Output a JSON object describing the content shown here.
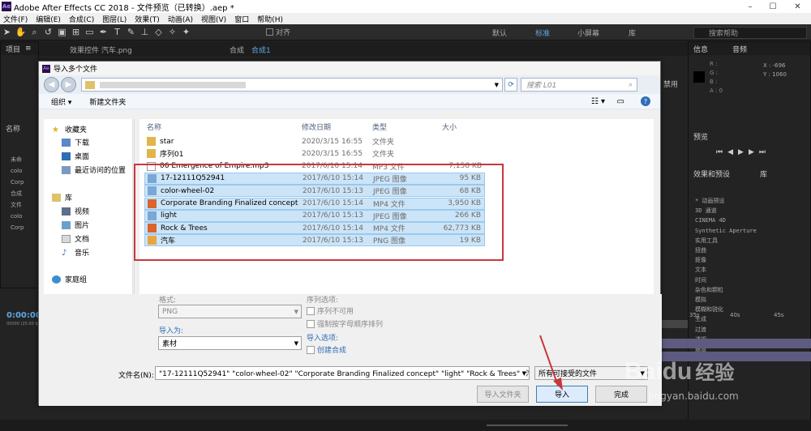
{
  "app": {
    "title": "Adobe After Effects CC 2018 - 文件预览（已转换）.aep *",
    "logo": "Ae"
  },
  "menu": [
    "文件(F)",
    "编辑(E)",
    "合成(C)",
    "图层(L)",
    "效果(T)",
    "动画(A)",
    "视图(V)",
    "窗口",
    "帮助(H)"
  ],
  "toolbar": {
    "align": "对齐",
    "workspaces": [
      "默认",
      "标准",
      "小屏幕",
      "库"
    ],
    "search": "搜索帮助"
  },
  "left_panel": {
    "tab": "项目",
    "items": [
      "名称",
      "未命",
      "colo",
      "Corp",
      "合成",
      "文件",
      "colo",
      "Corp"
    ]
  },
  "tabs": {
    "effects_controls": "效果控件 汽车.png",
    "comp_prefix": "合成",
    "comp_name": "合成1"
  },
  "right_panel": {
    "info": "信息",
    "audio": "音频",
    "rgb": [
      "R :",
      "G :",
      "B :",
      "A : 0"
    ],
    "x": "X : -696",
    "y": "Y : 1060",
    "preview": "预览",
    "effects": "效果和预设",
    "lib": "库",
    "effects_list": [
      "* 动画预设",
      "3D 通道",
      "CINEMA 4D",
      "Synthetic Aperture",
      "实用工具",
      "扭曲",
      "抠像",
      "文本",
      "时间",
      "杂色和颗粒",
      "模拟",
      "模糊和锐化",
      "生成",
      "过渡",
      "透视",
      "通道",
      "遮罩"
    ]
  },
  "timeline": {
    "timecode": "0:00:00:00",
    "frames": "00000 (25.00 fps)",
    "ticks": [
      "35s",
      "40s",
      "45s"
    ],
    "extra": "禁用"
  },
  "dialog": {
    "title": "导入多个文件",
    "search_placeholder": "搜索 L01",
    "organize": "组织 ▾",
    "new_folder": "新建文件夹",
    "nav": {
      "favorites": "收藏夹",
      "downloads": "下载",
      "desktop": "桌面",
      "recent": "最近访问的位置",
      "library": "库",
      "videos": "视频",
      "pictures": "图片",
      "documents": "文档",
      "music": "音乐",
      "homegroup": "家庭组"
    },
    "columns": {
      "name": "名称",
      "date": "修改日期",
      "type": "类型",
      "size": "大小"
    },
    "files": [
      {
        "name": "star",
        "date": "2020/3/15 16:55",
        "type": "文件夹",
        "size": "",
        "icon": "folder",
        "sel": false
      },
      {
        "name": "序列01",
        "date": "2020/3/15 16:55",
        "type": "文件夹",
        "size": "",
        "icon": "folder",
        "sel": false
      },
      {
        "name": "06 Emergence of Empire.mp3",
        "date": "2017/6/10 15:14",
        "type": "MP3 文件",
        "size": "7,158 KB",
        "icon": "mp3",
        "sel": false
      },
      {
        "name": "17-12111Q52941",
        "date": "2017/6/10 15:14",
        "type": "JPEG 图像",
        "size": "95 KB",
        "icon": "jpeg",
        "sel": true
      },
      {
        "name": "color-wheel-02",
        "date": "2017/6/10 15:13",
        "type": "JPEG 图像",
        "size": "68 KB",
        "icon": "jpeg",
        "sel": true
      },
      {
        "name": "Corporate Branding  Finalized concept",
        "date": "2017/6/10 15:14",
        "type": "MP4 文件",
        "size": "3,950 KB",
        "icon": "mp4",
        "sel": true
      },
      {
        "name": "light",
        "date": "2017/6/10 15:13",
        "type": "JPEG 图像",
        "size": "266 KB",
        "icon": "jpeg",
        "sel": true
      },
      {
        "name": "Rock & Trees",
        "date": "2017/6/10 15:14",
        "type": "MP4 文件",
        "size": "62,773 KB",
        "icon": "mp4",
        "sel": true
      },
      {
        "name": "汽车",
        "date": "2017/6/10 15:13",
        "type": "PNG 图像",
        "size": "19 KB",
        "icon": "png",
        "sel": true
      }
    ],
    "format_label": "格式:",
    "format_value": "PNG",
    "sequence_options": "序列选项:",
    "sequence_unavailable": "序列不可用",
    "force_alpha": "强制按字母顺序排列",
    "import_as_label": "导入为:",
    "import_as_value": "素材",
    "import_options": "导入选项:",
    "create_comp": "创建合成",
    "filename_label": "文件名(N):",
    "filename_value": "\"17-12111Q52941\" \"color-wheel-02\" \"Corporate Branding  Finalized concept\" \"light\" \"Rock & Trees\" \"汽:",
    "filter": "所有可接受的文件",
    "import_folder": "导入文件夹",
    "import_btn": "导入",
    "done_btn": "完成"
  },
  "watermark": {
    "brand": "Baidu",
    "cn": "经验",
    "url": "jingyan.baidu.com"
  },
  "colors": {
    "accent_red": "#c8373c",
    "selection": "#cce4f7"
  }
}
